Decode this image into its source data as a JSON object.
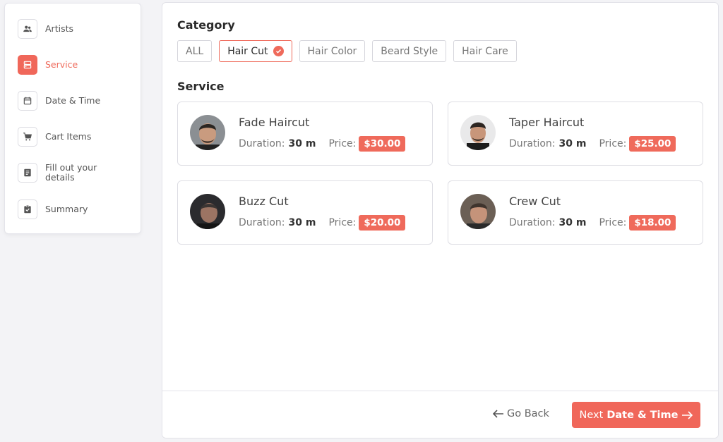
{
  "sidebar": {
    "steps": [
      {
        "label": "Artists",
        "icon": "people-icon"
      },
      {
        "label": "Service",
        "icon": "service-icon",
        "active": true
      },
      {
        "label": "Date & Time",
        "icon": "calendar-icon"
      },
      {
        "label": "Cart Items",
        "icon": "cart-icon"
      },
      {
        "label": "Fill out your details",
        "icon": "form-icon"
      },
      {
        "label": "Summary",
        "icon": "clipboard-check-icon"
      }
    ]
  },
  "main": {
    "category_title": "Category",
    "categories": [
      {
        "label": "ALL",
        "selected": false
      },
      {
        "label": "Hair Cut",
        "selected": true
      },
      {
        "label": "Hair Color",
        "selected": false
      },
      {
        "label": "Beard Style",
        "selected": false
      },
      {
        "label": "Hair Care",
        "selected": false
      }
    ],
    "service_title": "Service",
    "services": [
      {
        "name": "Fade Haircut",
        "duration_label": "Duration:",
        "duration": "30 m",
        "price_label": "Price:",
        "price": "$30.00"
      },
      {
        "name": "Taper Haircut",
        "duration_label": "Duration:",
        "duration": "30 m",
        "price_label": "Price:",
        "price": "$25.00"
      },
      {
        "name": "Buzz Cut",
        "duration_label": "Duration:",
        "duration": "30 m",
        "price_label": "Price:",
        "price": "$20.00"
      },
      {
        "name": "Crew Cut",
        "duration_label": "Duration:",
        "duration": "30 m",
        "price_label": "Price:",
        "price": "$18.00"
      }
    ]
  },
  "footer": {
    "back_label": "Go Back",
    "next_prefix": "Next",
    "next_step": "Date & Time"
  },
  "colors": {
    "accent": "#ef6a5b",
    "background": "#f3f3f6"
  }
}
